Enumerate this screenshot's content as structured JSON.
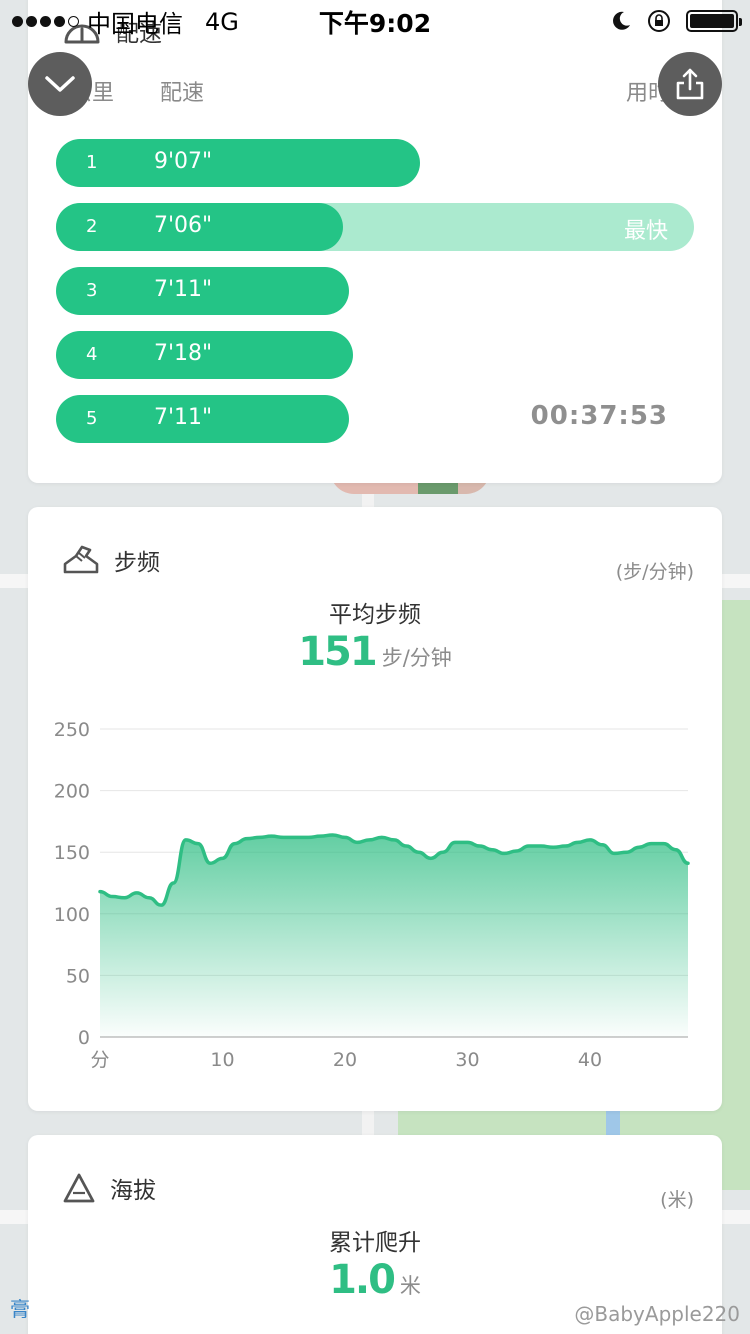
{
  "status_bar": {
    "carrier": "中国电信",
    "network": "4G",
    "time": "下午9:02"
  },
  "pace_section": {
    "title": "配速",
    "icon": "speedometer-icon",
    "columns": {
      "km": "公里",
      "pace": "配速",
      "time": "用时"
    },
    "rows": [
      {
        "index": "1",
        "pace": "9'07\"",
        "level": 0.57,
        "tag": ""
      },
      {
        "index": "2",
        "pace": "7'06\"",
        "level": 0.45,
        "tag": "最快"
      },
      {
        "index": "3",
        "pace": "7'11\"",
        "level": 0.46,
        "tag": ""
      },
      {
        "index": "4",
        "pace": "7'18\"",
        "level": 0.465,
        "tag": ""
      },
      {
        "index": "5",
        "pace": "7'11\"",
        "level": 0.46,
        "tag": ""
      }
    ],
    "total_time": "00:37:53"
  },
  "buttons": {
    "collapse_icon": "chevron-down-icon",
    "share_icon": "share-icon"
  },
  "cadence_section": {
    "title": "步频",
    "icon": "shoe-icon",
    "unit_label": "(步/分钟)",
    "metric_title": "平均步频",
    "metric_value": "151",
    "metric_unit": "步/分钟"
  },
  "chart_data": {
    "type": "area",
    "xlabel": "分",
    "ylabel": "",
    "x_ticks": [
      "分",
      "10",
      "20",
      "30",
      "40"
    ],
    "y_ticks": [
      "0",
      "50",
      "100",
      "150",
      "200",
      "250"
    ],
    "xlim": [
      0,
      48
    ],
    "ylim": [
      0,
      250
    ],
    "grid": true,
    "color": "#2fbe84",
    "series": [
      {
        "x": [
          0,
          1,
          2,
          3,
          4,
          5,
          6,
          7,
          8,
          9,
          10,
          11,
          12,
          13,
          14,
          15,
          16,
          17,
          18,
          19,
          20,
          21,
          22,
          23,
          24,
          25,
          26,
          27,
          28,
          29,
          30,
          31,
          32,
          33,
          34,
          35,
          36,
          37,
          38,
          39,
          40,
          41,
          42,
          43,
          44,
          45,
          46,
          47,
          48
        ],
        "values": [
          118,
          114,
          113,
          117,
          113,
          107,
          125,
          160,
          157,
          141,
          145,
          157,
          161,
          162,
          163,
          162,
          162,
          162,
          163,
          164,
          162,
          158,
          160,
          162,
          160,
          155,
          150,
          145,
          150,
          158,
          158,
          155,
          152,
          149,
          151,
          155,
          155,
          154,
          155,
          158,
          160,
          156,
          149,
          150,
          154,
          157,
          157,
          152,
          141
        ]
      }
    ]
  },
  "altitude_section": {
    "title": "海拔",
    "icon": "mountain-icon",
    "unit_label": "(米)",
    "metric_title": "累计爬升",
    "metric_value": "1.0",
    "metric_unit": "米"
  },
  "watermark": "@BabyApple220"
}
